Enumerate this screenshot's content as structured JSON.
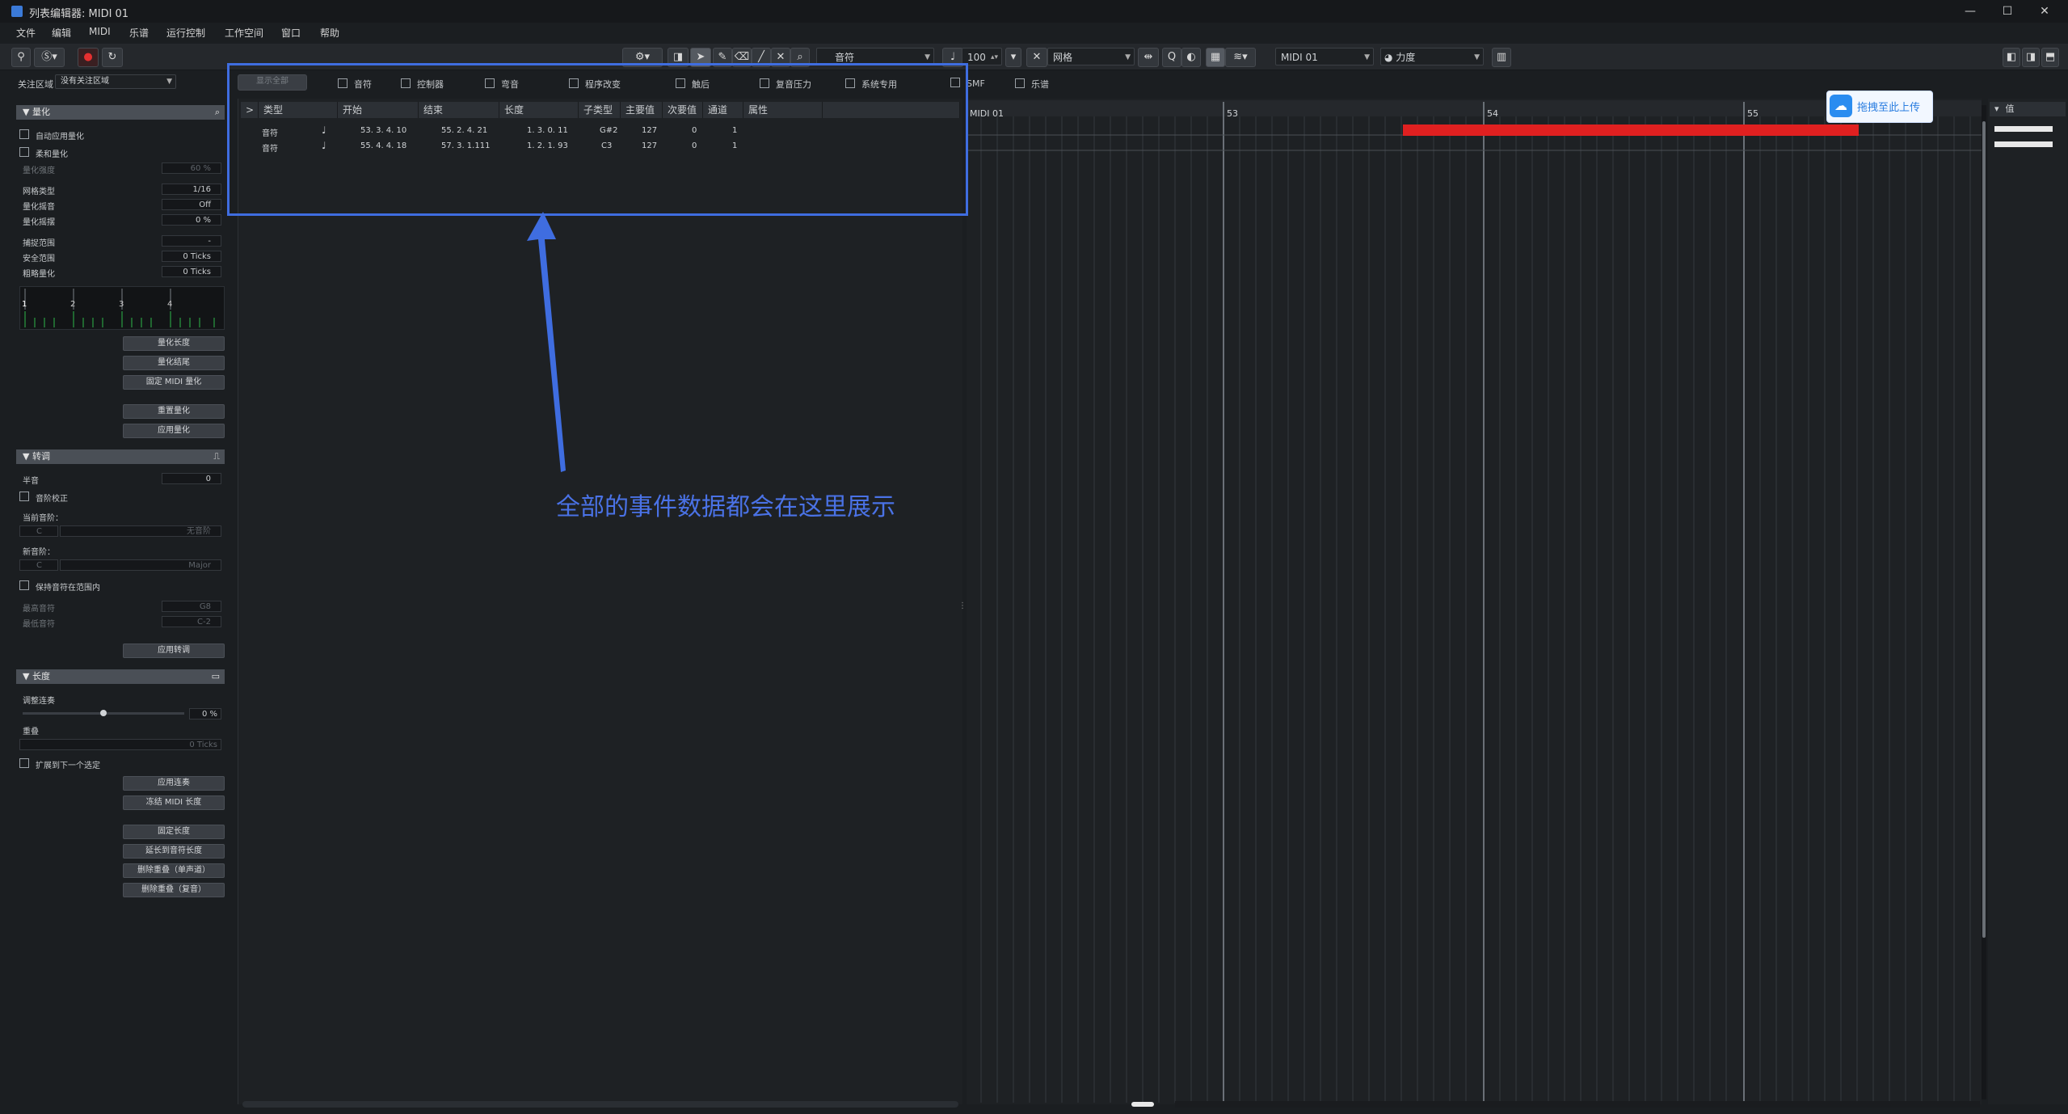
{
  "window": {
    "title": "列表编辑器: MIDI 01",
    "controls": [
      "—",
      "☐",
      "✕"
    ]
  },
  "menu": [
    "文件",
    "编辑",
    "MIDI",
    "乐谱",
    "运行控制",
    "工作空间",
    "窗口",
    "帮助"
  ],
  "toolbar": {
    "quantize_value": "100",
    "insert_type": "音符",
    "snap_mode": "网格",
    "track_name": "MIDI 01",
    "controller_lane": "力度"
  },
  "filter": {
    "focus_label": "关注区域",
    "focus_value": "没有关注区域",
    "show_all": "显示全部",
    "items": [
      "音符",
      "控制器",
      "弯音",
      "程序改变",
      "触后",
      "复音压力",
      "系统专用",
      "SMF",
      "乐谱"
    ]
  },
  "inspector": {
    "quantize": {
      "title": "量化",
      "auto_apply": "自动应用量化",
      "soft_quantize": "柔和量化",
      "strength_label": "量化强度",
      "strength_value": "60 %",
      "grid_type_label": "网格类型",
      "grid_type_value": "1/16",
      "swing_label": "量化摇音",
      "swing_value": "Off",
      "swing2_label": "量化摇摆",
      "swing2_value": "0 %",
      "capture_label": "捕捉范围",
      "capture_value": "-",
      "safe_label": "安全范围",
      "safe_value": "0 Ticks",
      "random_label": "粗略量化",
      "random_value": "0 Ticks",
      "grid_numbers": [
        "1",
        "2",
        "3",
        "4"
      ],
      "btn_len": "量化长度",
      "btn_end": "量化结尾",
      "btn_fixed": "固定 MIDI 量化",
      "btn_reset": "重置量化",
      "btn_apply": "应用量化"
    },
    "transpose": {
      "title": "转调",
      "semitone_label": "半音",
      "semitone_value": "0",
      "scale_correct": "音阶校正",
      "current_scale": "当前音阶：",
      "current_root": "C",
      "current_type": "无音阶",
      "new_scale": "新音阶：",
      "new_root": "C",
      "new_type": "Major",
      "keep_range": "保持音符在范围内",
      "high_label": "最高音符",
      "high_value": "G8",
      "low_label": "最低音符",
      "low_value": "C-2",
      "btn_apply": "应用转调"
    },
    "length": {
      "title": "长度",
      "legato_label": "调整连奏",
      "legato_value": "0 %",
      "overlap_label": "重叠",
      "overlap_value": "0 Ticks",
      "extend_next": "扩展到下一个选定",
      "btn_legato": "应用连奏",
      "btn_freeze": "冻结 MIDI 长度",
      "btn_fixed": "固定长度",
      "btn_scale": "延长到音符长度",
      "btn_del_mono": "删除重叠（单声道）",
      "btn_del_poly": "删除重叠（复音）"
    }
  },
  "list": {
    "headers": [
      ">",
      "类型",
      "开始",
      "结束",
      "长度",
      "子类型",
      "主要值",
      "次要值",
      "通道",
      "属性"
    ],
    "rows": [
      {
        "type": "音符",
        "start": "53. 3. 4. 10",
        "end": "55. 2. 4. 21",
        "length": "1. 3. 0. 11",
        "subtype": "G#2",
        "main": "127",
        "secondary": "0",
        "channel": "1"
      },
      {
        "type": "音符",
        "start": "55. 4. 4. 18",
        "end": "57. 3. 1.111",
        "length": "1. 2. 1. 93",
        "subtype": "C3",
        "main": "127",
        "secondary": "0",
        "channel": "1"
      }
    ]
  },
  "roll": {
    "track_label": "MIDI 01",
    "bars": [
      "53",
      "54",
      "55"
    ],
    "note_color": "#e02020"
  },
  "right_panel": {
    "value_label": "值"
  },
  "annotation": "全部的事件数据都会在这里展示",
  "upload_badge": "拖拽至此上传",
  "accent": "#3f6de0"
}
